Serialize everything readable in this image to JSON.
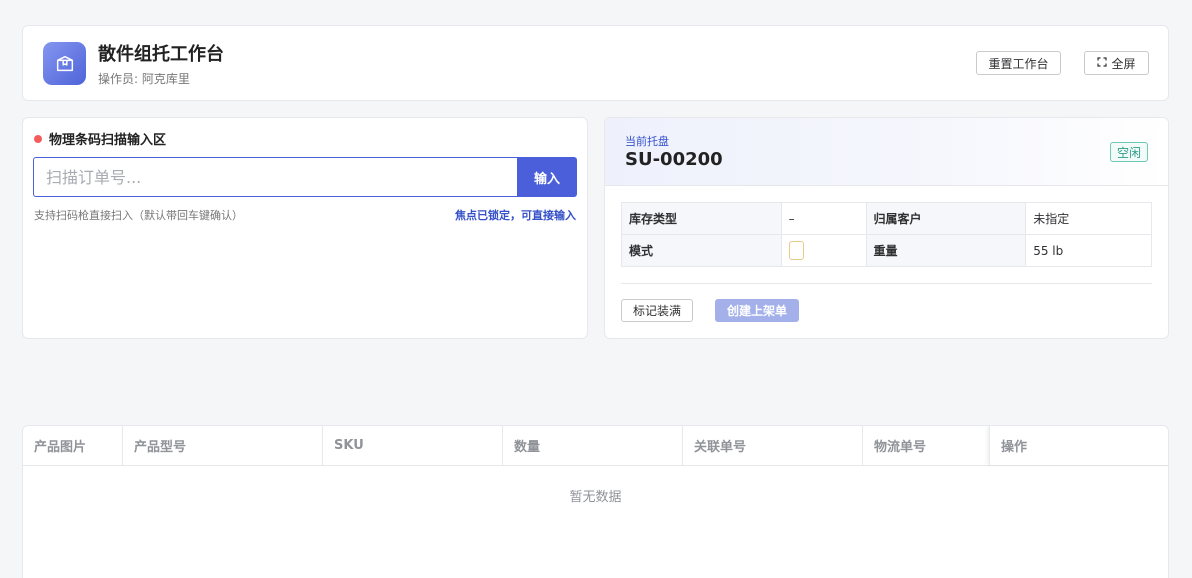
{
  "header": {
    "title": "散件组托工作台",
    "operator": "操作员: 阿克库里",
    "reset_label": "重置工作台",
    "fullscreen_label": "全屏"
  },
  "scan": {
    "title": "物理条码扫描输入区",
    "placeholder": "扫描订单号...",
    "submit_label": "输入",
    "hint": "支持扫码枪直接扫入（默认带回车键确认）",
    "focus_status": "焦点已锁定，可直接输入"
  },
  "pallet": {
    "label": "当前托盘",
    "id": "SU-00200",
    "status": "空闲",
    "rows": [
      {
        "k1": "库存类型",
        "v1": "–",
        "k2": "归属客户",
        "v2": "未指定"
      },
      {
        "k1": "模式",
        "v1": "",
        "k2": "重量",
        "v2": "55 lb"
      }
    ],
    "mark_full_label": "标记装满",
    "create_label": "创建上架单"
  },
  "table": {
    "columns": [
      "产品图片",
      "产品型号",
      "SKU",
      "数量",
      "关联单号",
      "物流单号",
      "操作"
    ],
    "empty_text": "暂无数据"
  },
  "colors": {
    "primary": "#4a5fd9",
    "status_idle": "#2c9c88",
    "indicator_dot": "#f25c5c"
  }
}
